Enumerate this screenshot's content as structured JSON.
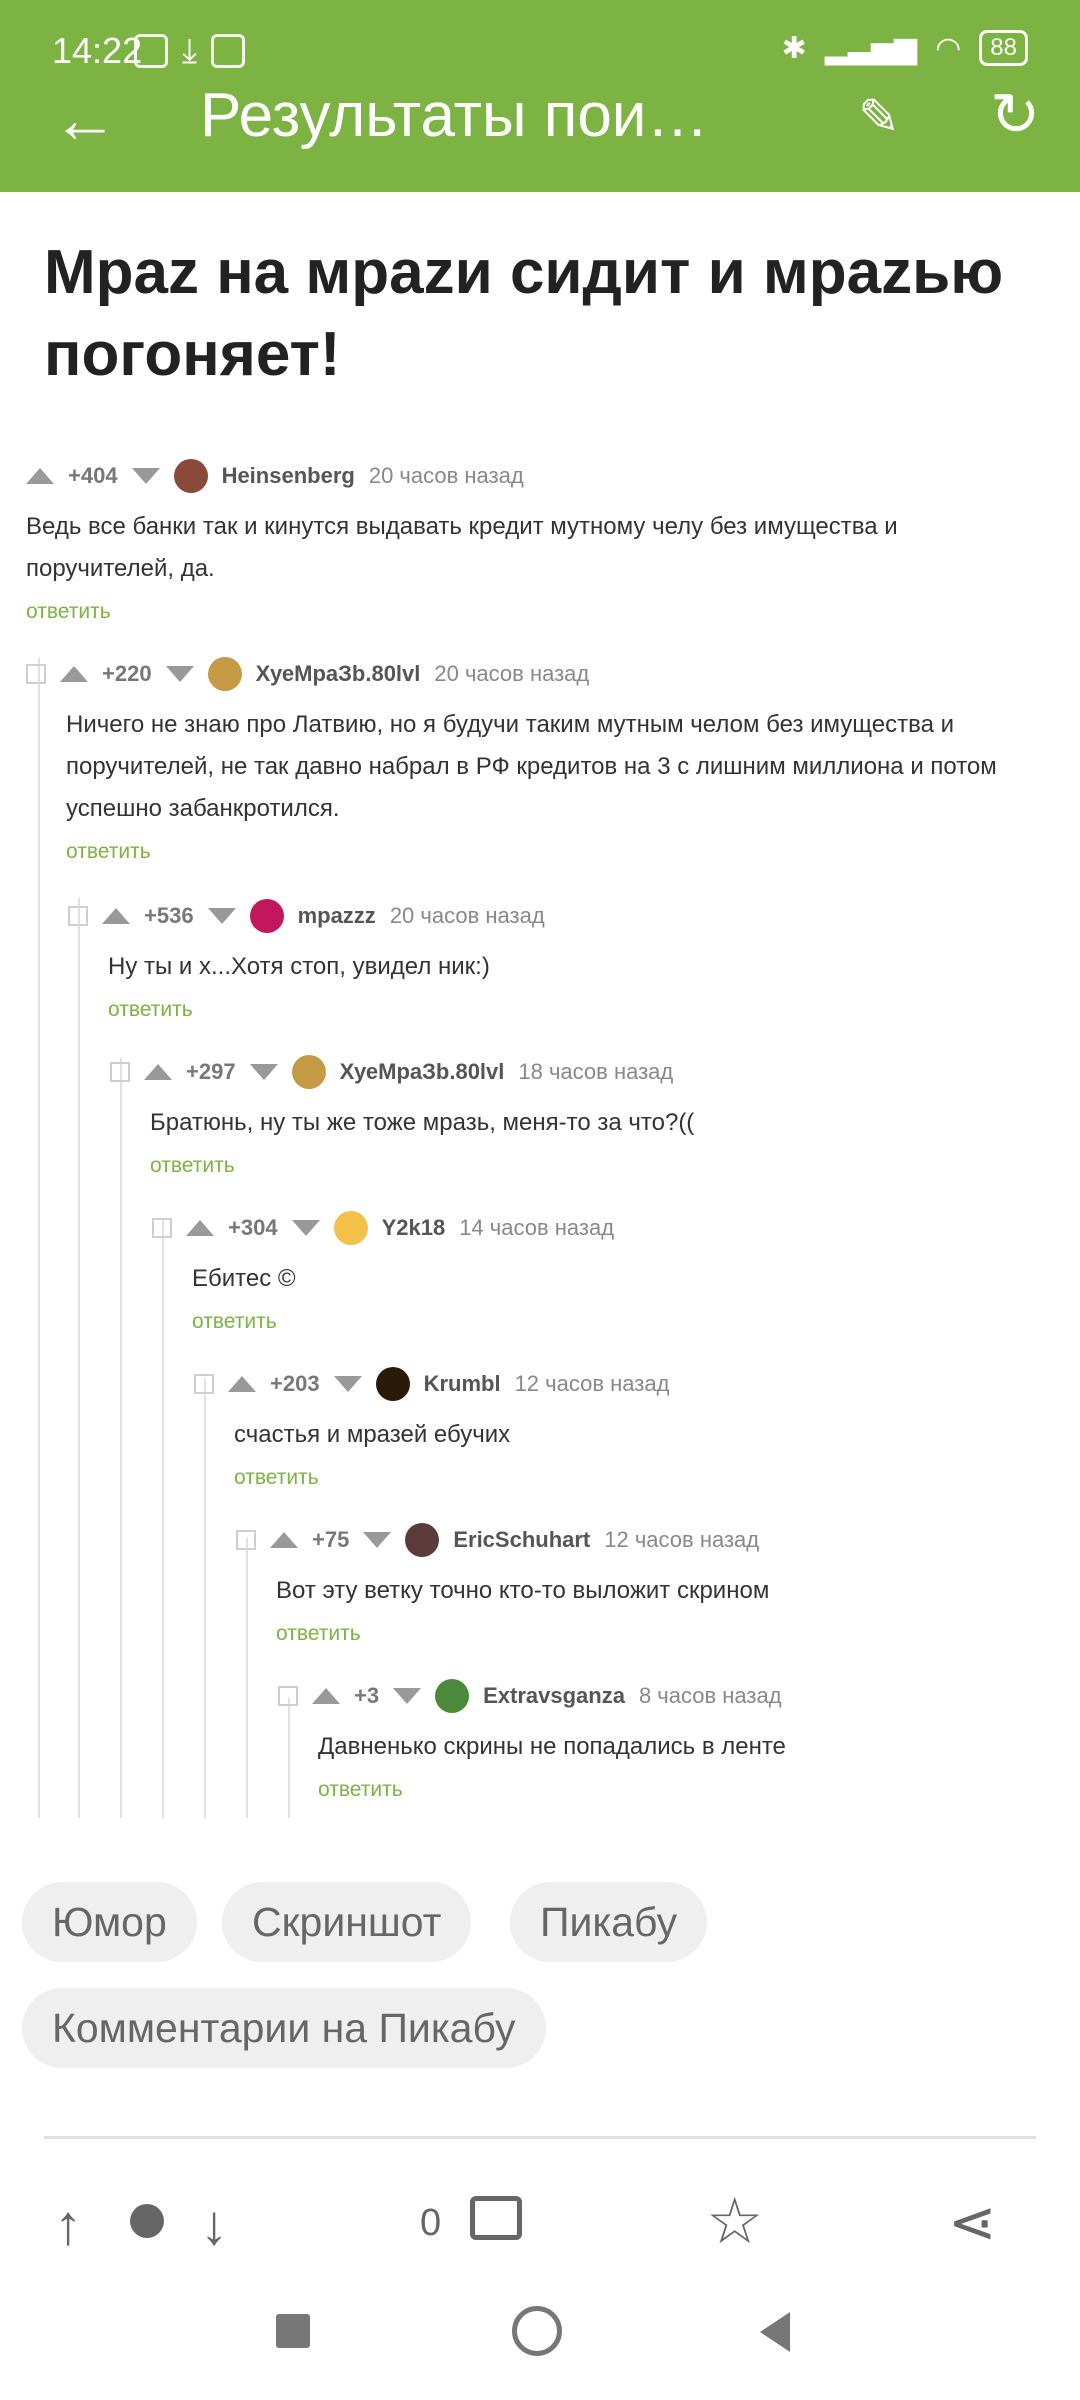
{
  "status_bar": {
    "time": "14:22",
    "battery": "88"
  },
  "header": {
    "title": "Результаты пои…"
  },
  "post": {
    "title": "Мраz на мраzи сидит и мраzью погоняет!"
  },
  "comments": [
    {
      "score": "+404",
      "nick": "Heinsenberg",
      "time": "20 часов назад",
      "text": "Ведь все банки так и кинутся выдавать кредит мутному челу без имущества и поручителей, да.",
      "reply": "ответить"
    },
    {
      "score": "+220",
      "nick": "ХуеМраЗb.80lvl",
      "time": "20 часов назад",
      "text": "Ничего не знаю про Латвию, но я будучи таким мутным челом без имущества и поручителей, не так давно набрал в РФ кредитов на 3 с лишним миллиона и потом успешно забанкротился.",
      "reply": "ответить"
    },
    {
      "score": "+536",
      "nick": "mpazzz",
      "time": "20 часов назад",
      "text": "Ну ты и х...Хотя стоп, увидел ник:)",
      "reply": "ответить"
    },
    {
      "score": "+297",
      "nick": "ХуеМраЗb.80lvl",
      "time": "18 часов назад",
      "text": "Братюнь, ну ты же тоже мразь, меня-то за что?((",
      "reply": "ответить"
    },
    {
      "score": "+304",
      "nick": "Y2k18",
      "time": "14 часов назад",
      "text": "Ебитес ©",
      "reply": "ответить"
    },
    {
      "score": "+203",
      "nick": "Krumbl",
      "time": "12 часов назад",
      "text": "счастья и мразей ебучих",
      "reply": "ответить"
    },
    {
      "score": "+75",
      "nick": "EricSchuhart",
      "time": "12 часов назад",
      "text": "Вот эту ветку точно кто-то выложит скрином",
      "reply": "ответить"
    },
    {
      "score": "+3",
      "nick": "Extravsganza",
      "time": "8 часов назад",
      "text": "Давненько скрины не попадались в ленте",
      "reply": "ответить"
    }
  ],
  "tags": [
    "Юмор",
    "Скриншот",
    "Пикабу",
    "Комментарии на Пикабу"
  ],
  "toolbar": {
    "comment_count": "0"
  }
}
